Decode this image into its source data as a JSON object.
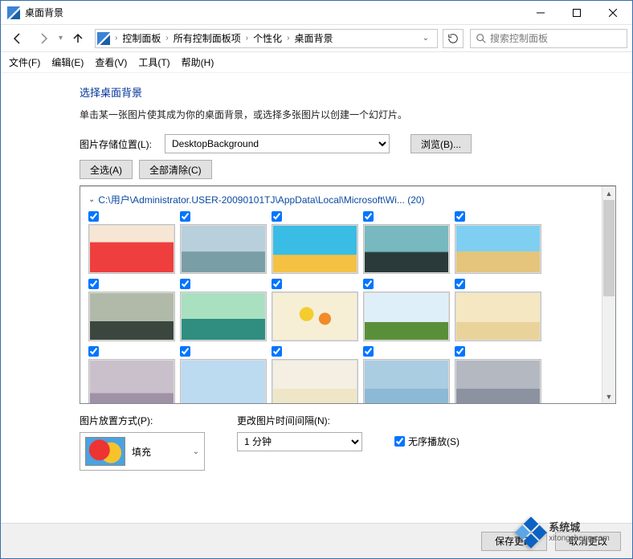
{
  "window": {
    "title": "桌面背景"
  },
  "nav": {
    "crumbs": [
      "控制面板",
      "所有控制面板项",
      "个性化",
      "桌面背景"
    ],
    "search_placeholder": "搜索控制面板"
  },
  "menubar": [
    "文件(F)",
    "编辑(E)",
    "查看(V)",
    "工具(T)",
    "帮助(H)"
  ],
  "page": {
    "heading": "选择桌面背景",
    "subtext": "单击某一张图片使其成为你的桌面背景，或选择多张图片以创建一个幻灯片。",
    "location_label": "图片存储位置(L):",
    "location_value": "DesktopBackground",
    "browse_btn": "浏览(B)...",
    "select_all_btn": "全选(A)",
    "clear_all_btn": "全部清除(C)",
    "folder_header": "C:\\用户\\Administrator.USER-20090101TJ\\AppData\\Local\\Microsoft\\Wi... (20)",
    "position_label": "图片放置方式(P):",
    "position_value": "填充",
    "interval_label": "更改图片时间间隔(N):",
    "interval_value": "1 分钟",
    "shuffle_label": "无序播放(S)"
  },
  "footer": {
    "save": "保存更改",
    "cancel": "取消更改"
  },
  "watermark": {
    "name": "系统城",
    "url": "xitongcheng.com"
  },
  "items": [
    {
      "checked": true,
      "cls": "t1"
    },
    {
      "checked": true,
      "cls": "t2"
    },
    {
      "checked": true,
      "cls": "t3"
    },
    {
      "checked": true,
      "cls": "t4"
    },
    {
      "checked": true,
      "cls": "t5"
    },
    {
      "checked": true,
      "cls": "t6"
    },
    {
      "checked": true,
      "cls": "t7"
    },
    {
      "checked": true,
      "cls": "t8"
    },
    {
      "checked": true,
      "cls": "t9"
    },
    {
      "checked": true,
      "cls": "t10"
    },
    {
      "checked": true,
      "cls": "t11"
    },
    {
      "checked": true,
      "cls": "t12"
    },
    {
      "checked": true,
      "cls": "t13"
    },
    {
      "checked": true,
      "cls": "t14"
    },
    {
      "checked": true,
      "cls": "t15"
    }
  ]
}
